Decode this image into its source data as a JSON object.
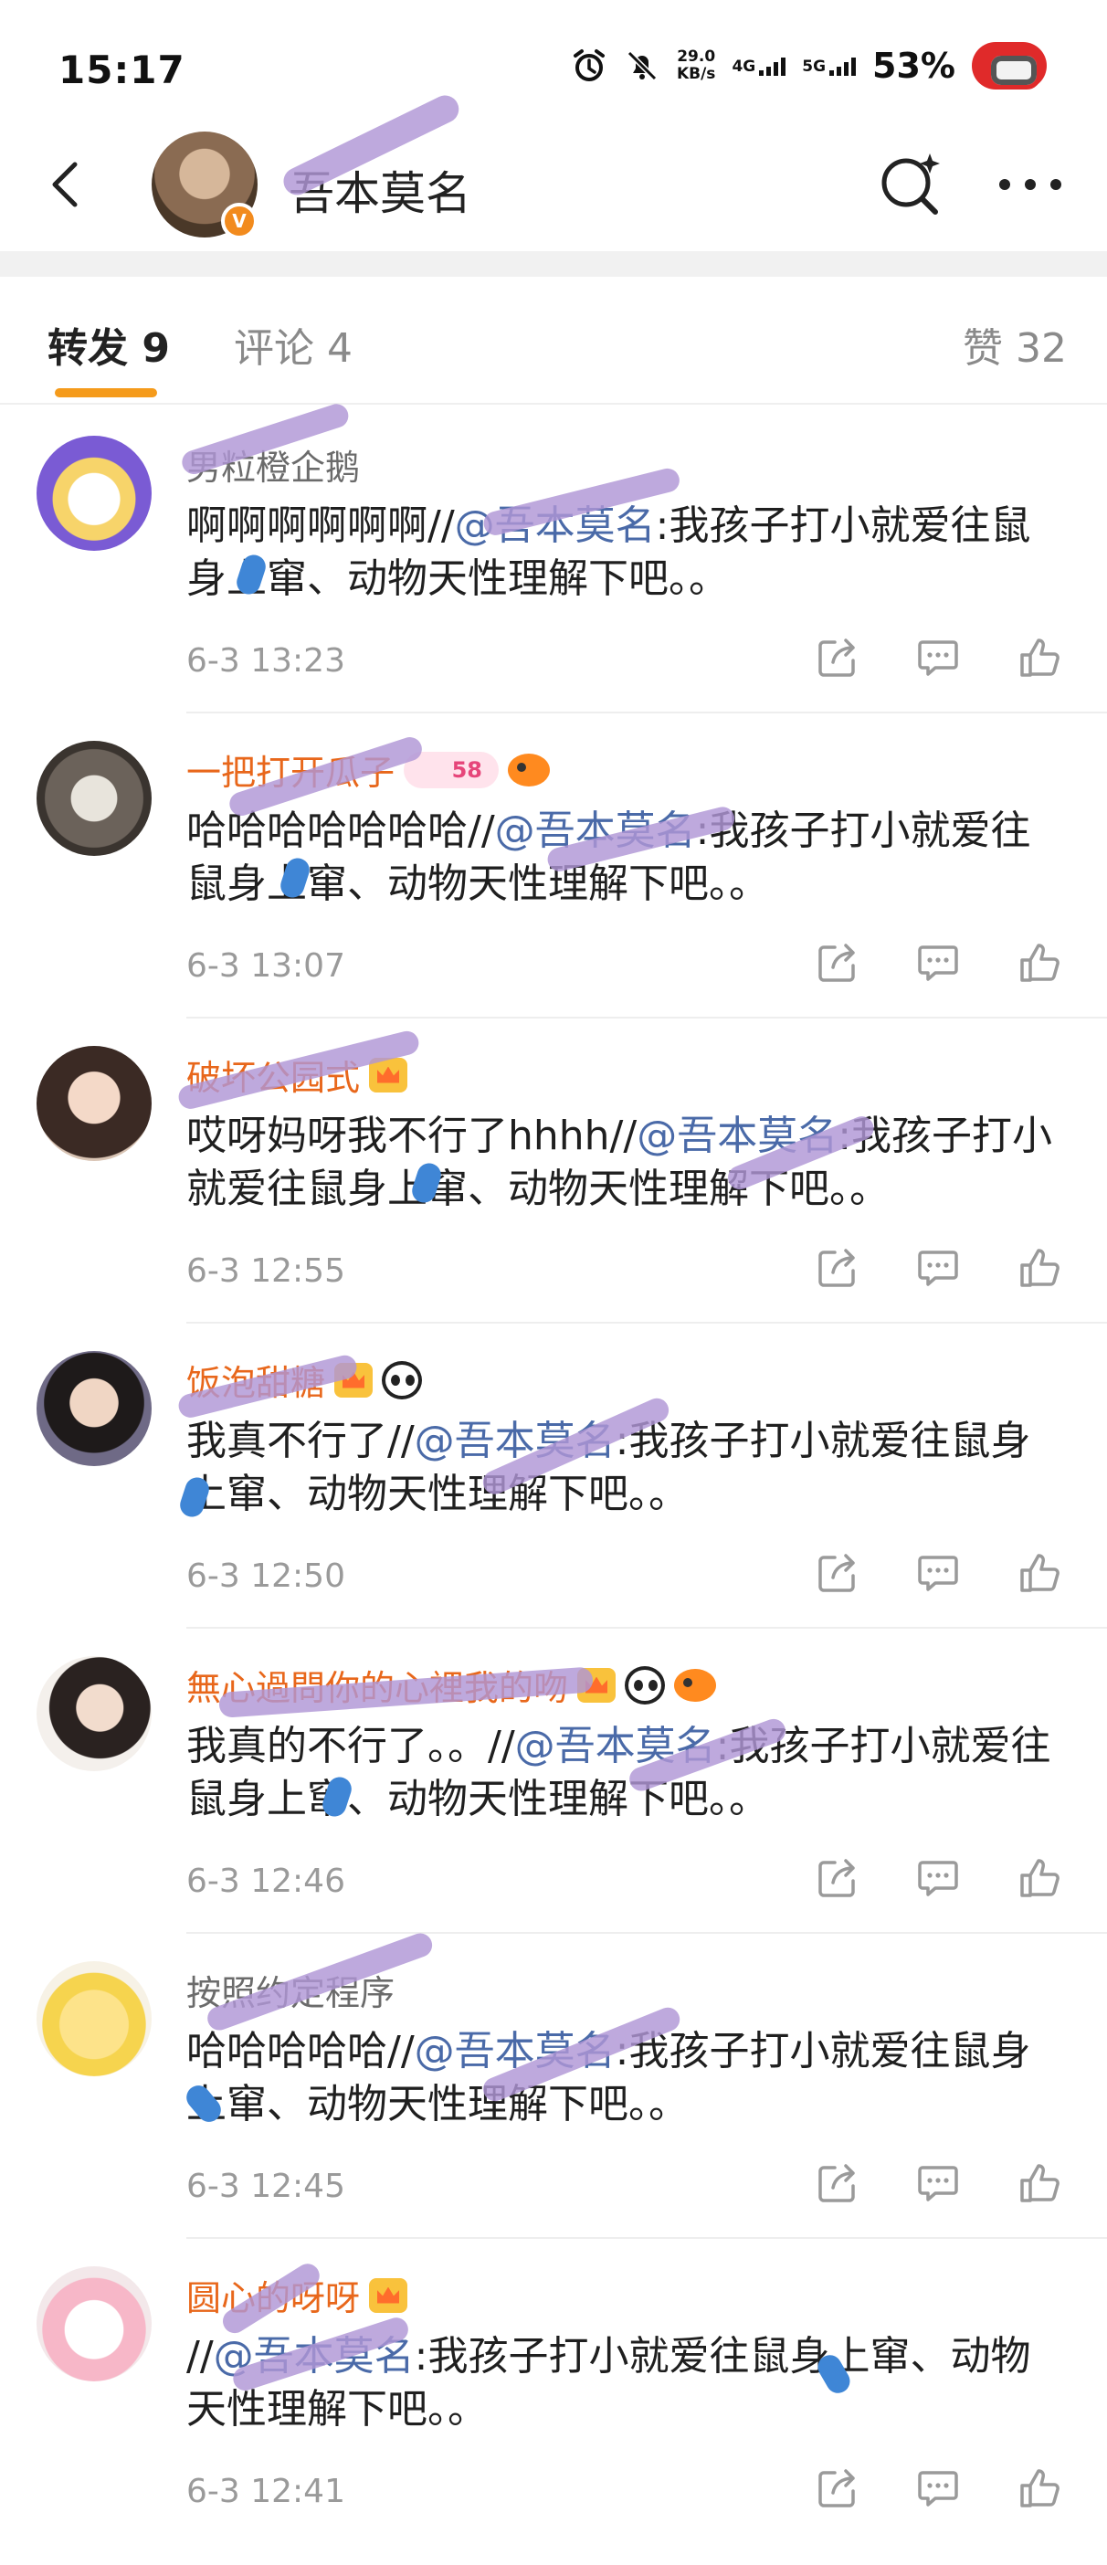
{
  "status_bar": {
    "time": "15:17",
    "net_speed_value": "29.0",
    "net_speed_unit": "KB/s",
    "net1": "4G",
    "net2": "5G",
    "battery": "53%"
  },
  "header": {
    "name": "吾本莫名",
    "verified_badge": "V",
    "icons": [
      "back-arrow-icon",
      "search-sparkle-icon",
      "more-icon"
    ]
  },
  "tabs": {
    "repost": "转发 9",
    "comment": "评论 4",
    "likes": "赞 32",
    "accent_color": "#f59b1b"
  },
  "reposts": [
    {
      "username": "男粒橙企鹅",
      "name_color": "gray",
      "badges": [],
      "prefix": "啊啊啊啊啊啊//",
      "mention": "@吾本莫名",
      "text": ":我孩子打小就爱往鼠身上窜、动物天性理解下吧。。",
      "time": "6-3 13:23"
    },
    {
      "username": "一把打开瓜子",
      "name_color": "orange",
      "badges": [
        "level-badge",
        "fish-badge"
      ],
      "level": "58",
      "prefix": "哈哈哈哈哈哈哈//",
      "mention": "@吾本莫名",
      "text": ":我孩子打小就爱往鼠身上窜、动物天性理解下吧。。",
      "time": "6-3 13:07"
    },
    {
      "username": "破坏公园式",
      "name_color": "orange",
      "badges": [
        "crown-badge"
      ],
      "prefix": "哎呀妈呀我不行了hhhh//",
      "mention": "@吾本莫名",
      "text": ":我孩子打小就爱往鼠身上窜、动物天性理解下吧。。",
      "time": "6-3 12:55"
    },
    {
      "username": "饭泡甜糖",
      "name_color": "orange",
      "badges": [
        "crown-badge",
        "panda-badge"
      ],
      "prefix": "我真不行了//",
      "mention": "@吾本莫名",
      "text": ":我孩子打小就爱往鼠身上窜、动物天性理解下吧。。",
      "time": "6-3 12:50"
    },
    {
      "username": "無心過問你的心裡我的吻",
      "name_color": "orange",
      "badges": [
        "crown-badge",
        "panda-badge",
        "fish-badge"
      ],
      "prefix": "我真的不行了。。//",
      "mention": "@吾本莫名",
      "text": ":我孩子打小就爱往鼠身上窜、动物天性理解下吧。。",
      "time": "6-3 12:46"
    },
    {
      "username": "按照约定程序",
      "name_color": "gray",
      "badges": [],
      "prefix": "哈哈哈哈哈//",
      "mention": "@吾本莫名",
      "text": ":我孩子打小就爱往鼠身上窜、动物天性理解下吧。。",
      "time": "6-3 12:45"
    },
    {
      "username": "圆心的呀呀",
      "name_color": "orange",
      "badges": [
        "crown-badge"
      ],
      "prefix": "//",
      "mention": "@吾本莫名",
      "text": ":我孩子打小就爱往鼠身上窜、动物天性理解下吧。。",
      "time": "6-3 12:41"
    }
  ],
  "row_action_icons": [
    "share-icon",
    "comment-icon",
    "like-icon"
  ],
  "colors": {
    "mention": "#4a6aa8",
    "orange_name": "#e8671b",
    "time_gray": "#9a9a9a",
    "redaction": "#b096d6"
  }
}
